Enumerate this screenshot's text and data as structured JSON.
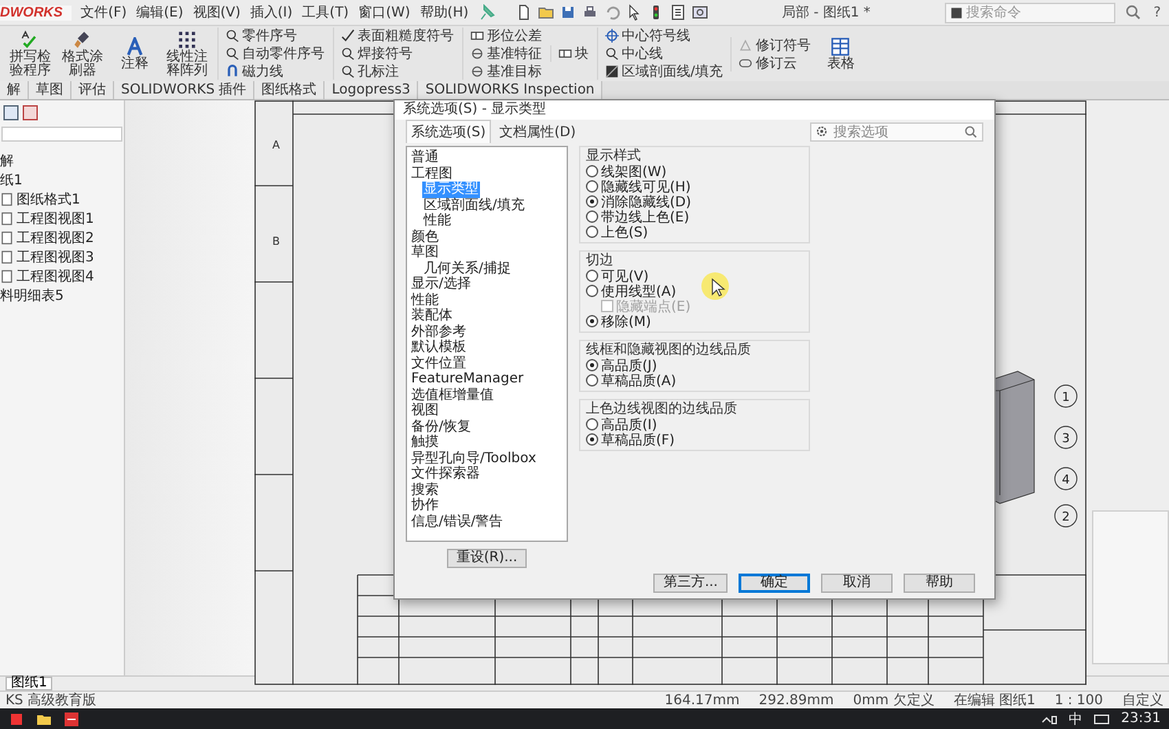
{
  "menu_bar": {
    "logo": "DWORKS",
    "menus": [
      "文件(F)",
      "编辑(E)",
      "视图(V)",
      "插入(I)",
      "工具(T)",
      "窗口(W)",
      "帮助(H)"
    ],
    "document_title": "局部 - 图纸1 *",
    "search": {
      "placeholder": "搜索命令"
    },
    "help": "?"
  },
  "ribbon": {
    "large_buttons": [
      {
        "label": "拼写检验程序",
        "kind": "spell"
      },
      {
        "label": "格式涂刷器",
        "kind": "brush"
      },
      {
        "label": "注释",
        "kind": "note"
      },
      {
        "label": "线性注释阵列",
        "kind": "pattern"
      }
    ],
    "groups": [
      {
        "items": [
          "零件序号",
          "自动零件序号",
          "磁力线"
        ]
      },
      {
        "items": [
          "表面粗糙度符号",
          "焊接符号",
          "孔标注"
        ]
      },
      {
        "items": [
          "形位公差",
          "基准特征",
          "基准目标"
        ]
      },
      {
        "items": [
          "块"
        ]
      },
      {
        "items": [
          "中心符号线",
          "中心线",
          "区域剖面线/填充"
        ]
      },
      {
        "items": [
          "修订符号",
          "修订云"
        ]
      }
    ],
    "table_button": "表格"
  },
  "command_tabs": [
    "解",
    "草图",
    "评估",
    "SOLIDWORKS 插件",
    "图纸格式",
    "Logopress3",
    "SOLIDWORKS Inspection"
  ],
  "feature_tree": {
    "items": [
      {
        "label": "解"
      },
      {
        "label": "纸1",
        "children": [
          {
            "label": "图纸格式1"
          },
          {
            "label": "工程图视图1"
          },
          {
            "label": "工程图视图2"
          },
          {
            "label": "工程图视图3"
          },
          {
            "label": "工程图视图4"
          }
        ]
      },
      {
        "label": "料明细表5"
      }
    ]
  },
  "sheet": {
    "zones": [
      "A",
      "B"
    ],
    "balloons": [
      "1",
      "3",
      "4",
      "2"
    ]
  },
  "dialog": {
    "title": "系统选项(S) - 显示类型",
    "tabs": [
      {
        "label": "系统选项(S)",
        "selected": true
      },
      {
        "label": "文档属性(D)",
        "selected": false
      }
    ],
    "search": {
      "placeholder": "搜索选项"
    },
    "tree": [
      {
        "label": "普通",
        "selected": false
      },
      {
        "label": "工程图",
        "selected": false,
        "children": [
          {
            "label": "显示类型",
            "selected": true
          },
          {
            "label": "区域剖面线/填充",
            "selected": false
          },
          {
            "label": "性能",
            "selected": false
          }
        ]
      },
      {
        "label": "颜色",
        "selected": false
      },
      {
        "label": "草图",
        "selected": false,
        "children": [
          {
            "label": "几何关系/捕捉",
            "selected": false
          }
        ]
      },
      {
        "label": "显示/选择",
        "selected": false
      },
      {
        "label": "性能",
        "selected": false
      },
      {
        "label": "装配体",
        "selected": false
      },
      {
        "label": "外部参考",
        "selected": false
      },
      {
        "label": "默认模板",
        "selected": false
      },
      {
        "label": "文件位置",
        "selected": false
      },
      {
        "label": "FeatureManager",
        "selected": false
      },
      {
        "label": "选值框增量值",
        "selected": false
      },
      {
        "label": "视图",
        "selected": false
      },
      {
        "label": "备份/恢复",
        "selected": false
      },
      {
        "label": "触摸",
        "selected": false
      },
      {
        "label": "异型孔向导/Toolbox",
        "selected": false
      },
      {
        "label": "文件探索器",
        "selected": false
      },
      {
        "label": "搜索",
        "selected": false
      },
      {
        "label": "协作",
        "selected": false
      },
      {
        "label": "信息/错误/警告",
        "selected": false
      }
    ],
    "reset_button": "重设(R)...",
    "groups": [
      {
        "title": "显示样式",
        "options": [
          {
            "kind": "radio",
            "label": "线架图(W)",
            "selected": false
          },
          {
            "kind": "radio",
            "label": "隐藏线可见(H)",
            "selected": false
          },
          {
            "kind": "radio",
            "label": "消除隐藏线(D)",
            "selected": true
          },
          {
            "kind": "radio",
            "label": "带边线上色(E)",
            "selected": false
          },
          {
            "kind": "radio",
            "label": "上色(S)",
            "selected": false
          }
        ]
      },
      {
        "title": "切边",
        "options": [
          {
            "kind": "radio",
            "label": "可见(V)",
            "selected": false
          },
          {
            "kind": "radio",
            "label": "使用线型(A)",
            "selected": false
          },
          {
            "kind": "checkbox",
            "label": "隐藏端点(E)",
            "checked": false,
            "disabled": true
          },
          {
            "kind": "radio",
            "label": "移除(M)",
            "selected": true
          }
        ]
      },
      {
        "title": "线框和隐藏视图的边线品质",
        "options": [
          {
            "kind": "radio",
            "label": "高品质(J)",
            "selected": true
          },
          {
            "kind": "radio",
            "label": "草稿品质(A)",
            "selected": false
          }
        ]
      },
      {
        "title": "上色边线视图的边线品质",
        "options": [
          {
            "kind": "radio",
            "label": "高品质(I)",
            "selected": false
          },
          {
            "kind": "radio",
            "label": "草稿品质(F)",
            "selected": true
          }
        ]
      }
    ],
    "buttons": [
      {
        "label": "第三方...",
        "default": false
      },
      {
        "label": "确定",
        "default": true
      },
      {
        "label": "取消",
        "default": false
      },
      {
        "label": "帮助",
        "default": false
      }
    ]
  },
  "sheet_tabs": [
    {
      "label": "图纸1",
      "selected": true
    }
  ],
  "status_bar": {
    "message": "KS 高级教育版",
    "fields": [
      "164.17mm",
      "292.89mm",
      "0mm 欠定义",
      "在编辑 图纸1",
      "1 : 100",
      "自定义"
    ]
  },
  "taskbar": {
    "ime": "中",
    "time": "23:31"
  }
}
